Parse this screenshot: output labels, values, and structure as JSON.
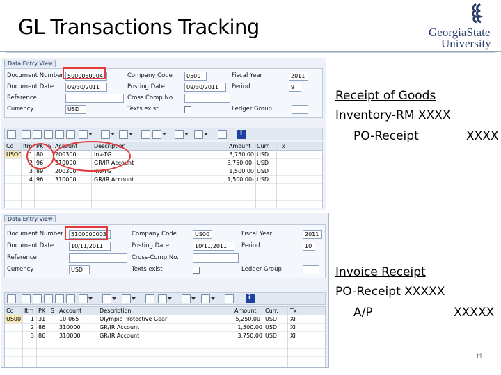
{
  "slide": {
    "title": "GL Transactions Tracking",
    "page_number": "11",
    "logo": {
      "line1": "GeorgiaState",
      "line2": "University"
    }
  },
  "receipt_goods": {
    "heading": "Receipt of Goods",
    "line1": "Inventory-RM  XXXX",
    "line2_label": "PO-Receipt",
    "line2_value": "XXXX"
  },
  "invoice_receipt": {
    "heading": "Invoice Receipt",
    "line1": "PO-Receipt  XXXXX",
    "line2_label": "A/P",
    "line2_value": "XXXXX"
  },
  "sap_top": {
    "view_tab": "Data Entry View",
    "fields": {
      "document_number_label": "Document Number",
      "document_number": "5000050004",
      "company_code_label": "Company Code",
      "company_code": "0500",
      "fiscal_year_label": "Fiscal Year",
      "fiscal_year": "2011",
      "document_date_label": "Document Date",
      "document_date": "09/30/2011",
      "posting_date_label": "Posting Date",
      "posting_date": "09/30/2011",
      "period_label": "Period",
      "period": "9",
      "reference_label": "Reference",
      "reference": "",
      "cross_comp_label": "Cross Comp.No.",
      "cross_comp": "",
      "currency_label": "Currency",
      "currency": "USD",
      "texts_exist_label": "Texts exist",
      "ledger_group_label": "Ledger Group",
      "ledger_group": ""
    },
    "columns": [
      "Co",
      "Itm",
      "PK",
      "S",
      "Account",
      "Description",
      "Amount",
      "Curr.",
      "Tx"
    ],
    "rows": [
      {
        "co": "USOO",
        "itm": "1",
        "pk": "80",
        "s": "",
        "account": "200300",
        "desc": "Inv-TG",
        "amount": "3,750.00",
        "curr": "USD",
        "tx": ""
      },
      {
        "co": "",
        "itm": "2",
        "pk": "96",
        "s": "",
        "account": "310000",
        "desc": "GR/IR Account",
        "amount": "3,750.00-",
        "curr": "USD",
        "tx": ""
      },
      {
        "co": "",
        "itm": "3",
        "pk": "89",
        "s": "",
        "account": "200300",
        "desc": "Inv-TG",
        "amount": "1,500.00",
        "curr": "USD",
        "tx": ""
      },
      {
        "co": "",
        "itm": "4",
        "pk": "96",
        "s": "",
        "account": "310000",
        "desc": "GR/IR Account",
        "amount": "1,500.00-",
        "curr": "USD",
        "tx": ""
      }
    ]
  },
  "sap_bottom": {
    "view_tab": "Data Entry View",
    "fields": {
      "document_number_label": "Document Number",
      "document_number": "5100000003",
      "company_code_label": "Company Code",
      "company_code": "US00",
      "fiscal_year_label": "Fiscal Year",
      "fiscal_year": "2011",
      "document_date_label": "Document Date",
      "document_date": "10/11/2011",
      "posting_date_label": "Posting Date",
      "posting_date": "10/11/2011",
      "period_label": "Period",
      "period": "10",
      "reference_label": "Reference",
      "reference": "",
      "cross_comp_label": "Cross-Comp.No.",
      "cross_comp": "",
      "currency_label": "Currency",
      "currency": "USD",
      "texts_exist_label": "Texts exist",
      "ledger_group_label": "Ledger Group",
      "ledger_group": ""
    },
    "columns": [
      "Co",
      "Itm",
      "PK",
      "S",
      "Account",
      "Description",
      "Amount",
      "Curr.",
      "Tx"
    ],
    "rows": [
      {
        "co": "US00",
        "itm": "1",
        "pk": "31",
        "s": "",
        "account": "10-065",
        "desc": "Olympic Protective Gear",
        "amount": "5,250.00-",
        "curr": "USD",
        "tx": "XI"
      },
      {
        "co": "",
        "itm": "2",
        "pk": "86",
        "s": "",
        "account": "310000",
        "desc": "GR/IR Account",
        "amount": "1,500.00",
        "curr": "USD",
        "tx": "XI"
      },
      {
        "co": "",
        "itm": "3",
        "pk": "86",
        "s": "",
        "account": "310000",
        "desc": "GR/IR Account",
        "amount": "3,750.00",
        "curr": "USD",
        "tx": "XI"
      }
    ]
  },
  "colors": {
    "annotation_red": "#e03a3a",
    "sap_panel_bg": "#eef2f8",
    "logo_blue": "#2a3f6b"
  }
}
